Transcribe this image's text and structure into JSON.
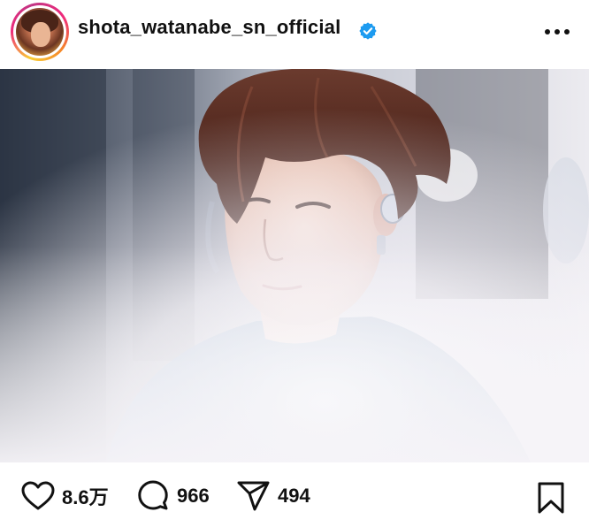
{
  "header": {
    "username": "shota_watanabe_sn_official",
    "verified": true,
    "avatar_icon": "profile-photo",
    "more_icon": "more-horizontal-icon"
  },
  "photo": {
    "icon": "post-photo-portrait"
  },
  "actions": {
    "like_count": "8.6万",
    "comment_count": "966",
    "share_count": "494",
    "like_icon": "heart-icon",
    "comment_icon": "comment-bubble-icon",
    "share_icon": "paper-plane-icon",
    "save_icon": "bookmark-icon"
  },
  "colors": {
    "text": "#111111",
    "verified_badge": "#1d9bf0",
    "background": "#ffffff"
  }
}
